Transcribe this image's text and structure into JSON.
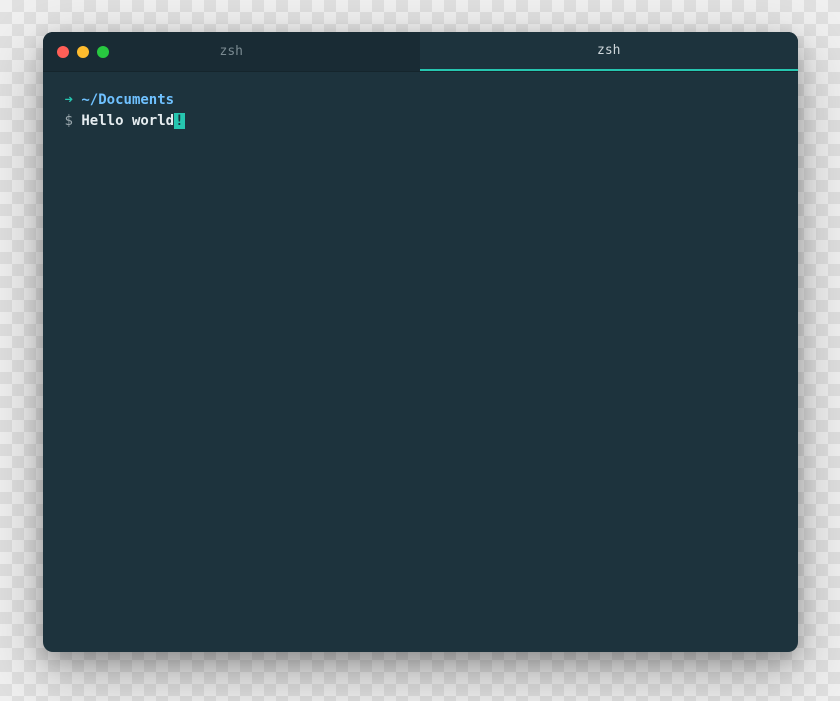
{
  "window": {
    "tabs": [
      {
        "label": "zsh",
        "active": false
      },
      {
        "label": "zsh",
        "active": true
      }
    ]
  },
  "prompt": {
    "arrow": "➜",
    "path": "~/Documents",
    "symbol": "$",
    "command": "Hello world",
    "cursor_char": "!"
  },
  "colors": {
    "bg": "#1d333d",
    "titlebar": "#1b2f38",
    "accent": "#26c6b0",
    "path": "#6fc1ff",
    "text": "#e6edf0"
  }
}
